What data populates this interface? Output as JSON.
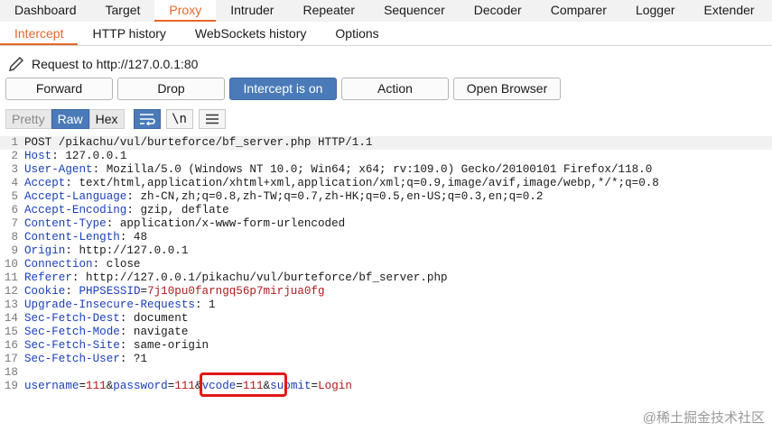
{
  "main_tabs": [
    "Dashboard",
    "Target",
    "Proxy",
    "Intruder",
    "Repeater",
    "Sequencer",
    "Decoder",
    "Comparer",
    "Logger",
    "Extender"
  ],
  "active_main_tab": "Proxy",
  "sub_tabs": [
    "Intercept",
    "HTTP history",
    "WebSockets history",
    "Options"
  ],
  "active_sub_tab": "Intercept",
  "request_info": "Request to http://127.0.0.1:80",
  "buttons": {
    "forward": "Forward",
    "drop": "Drop",
    "intercept": "Intercept is on",
    "action": "Action",
    "open_browser": "Open Browser"
  },
  "view_modes": [
    "Pretty",
    "Raw",
    "Hex"
  ],
  "active_view_mode": "Raw",
  "tool_buttons": {
    "newline": "\\n"
  },
  "request": {
    "line1": "POST /pikachu/vul/burteforce/bf_server.php HTTP/1.1",
    "headers": [
      {
        "name": "Host",
        "value": " 127.0.0.1"
      },
      {
        "name": "User-Agent",
        "value": " Mozilla/5.0 (Windows NT 10.0; Win64; x64; rv:109.0) Gecko/20100101 Firefox/118.0"
      },
      {
        "name": "Accept",
        "value": " text/html,application/xhtml+xml,application/xml;q=0.9,image/avif,image/webp,*/*;q=0.8"
      },
      {
        "name": "Accept-Language",
        "value": " zh-CN,zh;q=0.8,zh-TW;q=0.7,zh-HK;q=0.5,en-US;q=0.3,en;q=0.2"
      },
      {
        "name": "Accept-Encoding",
        "value": " gzip, deflate"
      },
      {
        "name": "Content-Type",
        "value": " application/x-www-form-urlencoded"
      },
      {
        "name": "Content-Length",
        "value": " 48"
      },
      {
        "name": "Origin",
        "value": " http://127.0.0.1"
      },
      {
        "name": "Connection",
        "value": " close"
      },
      {
        "name": "Referer",
        "value": " http://127.0.0.1/pikachu/vul/burteforce/bf_server.php"
      },
      {
        "name": "Cookie",
        "value": " PHPSESSID=7j10pu0farngq56p7mirjua0fg"
      },
      {
        "name": "Upgrade-Insecure-Requests",
        "value": " 1"
      },
      {
        "name": "Sec-Fetch-Dest",
        "value": " document"
      },
      {
        "name": "Sec-Fetch-Mode",
        "value": " navigate"
      },
      {
        "name": "Sec-Fetch-Site",
        "value": " same-origin"
      },
      {
        "name": "Sec-Fetch-User",
        "value": " ?1"
      }
    ],
    "body_params": [
      {
        "name": "username",
        "value": "111"
      },
      {
        "name": "password",
        "value": "111"
      },
      {
        "name": "vcode",
        "value": "111"
      },
      {
        "name": "submit",
        "value": "Login"
      }
    ]
  },
  "watermark": "@稀土掘金技术社区",
  "colors": {
    "accent": "#e8672a",
    "button_active": "#4a7ab8",
    "header_name": "#1a3fb8",
    "param_value": "#b01a1a",
    "highlight": "#e01818"
  }
}
